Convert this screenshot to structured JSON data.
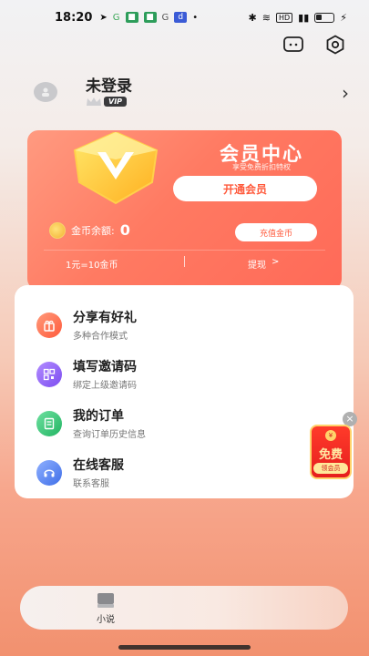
{
  "status_bar": {
    "time": "18:20",
    "battery_label": "",
    "network_label": "HD"
  },
  "top_icons": [
    "message-icon",
    "settings-hex-icon"
  ],
  "user": {
    "name": "未登录",
    "vip_label": "VIP"
  },
  "member_card": {
    "title": "会员中心",
    "subtitle": "享受免费折扣特权",
    "open_button": "开通会员",
    "coin_label": "金币余额:",
    "coin_value": "0",
    "recharge_button": "充值金币",
    "rate": "1元=10金币",
    "withdraw": "提现",
    "withdraw_arrow": ">"
  },
  "menu": {
    "items": [
      {
        "title": "分享有好礼",
        "subtitle": "多种合作模式",
        "icon": "gift-icon",
        "color": "#ff6a52"
      },
      {
        "title": "填写邀请码",
        "subtitle": "绑定上级邀请码",
        "icon": "qrcode-icon",
        "color": "#8b5cf6"
      },
      {
        "title": "我的订单",
        "subtitle": "查询订单历史信息",
        "icon": "order-icon",
        "color": "#2fbf71"
      },
      {
        "title": "在线客服",
        "subtitle": "联系客服",
        "icon": "headset-icon",
        "color": "#4a7bf2"
      }
    ]
  },
  "free_badge": {
    "main": "免费",
    "sub": "领会员",
    "close": "×",
    "coin": "¥"
  },
  "tab_bar": {
    "items": [
      {
        "label": "小说",
        "icon": "book-icon"
      }
    ]
  },
  "colors": {
    "accent": "#ff5a3c",
    "card_start": "#ff9a80",
    "card_end": "#ff6a58"
  }
}
